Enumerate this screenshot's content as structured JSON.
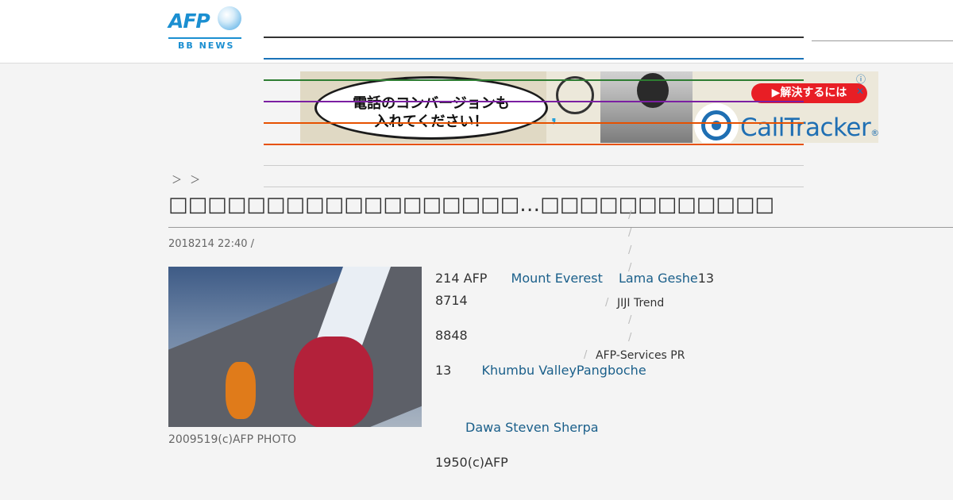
{
  "brand": {
    "logo": "AFP",
    "logo_sub": "BB NEWS"
  },
  "ad": {
    "bubble_line1": "電話のコンバージョンも",
    "bubble_line2": "入れてください！",
    "cta": "▶解決するには",
    "brand": "CallTracker",
    "brand_mark": "®",
    "info_icon": "ⓘ",
    "close_icon": "✕"
  },
  "colors": {
    "nav_lines": [
      "#333333",
      "#1a73b8",
      "#2e7d32",
      "#7b1fa2",
      "#e65100",
      "#e65100",
      "#cccccc",
      "#cccccc"
    ]
  },
  "breadcrumb": "＞ ＞",
  "article": {
    "title": "□□□□□□□□□□□□□□□□□□…□□□□□□□□□□□□",
    "meta": "2018214 22:40  /",
    "photo_caption": "2009519(c)AFP PHOTO",
    "p1_a": "214 AFP",
    "p1_link1": "Mount Everest",
    "p1_link2": "Lama Geshe",
    "p1_b": "13",
    "p2": "8714",
    "p3": "8848",
    "p4_a": "13",
    "p4_link": "Khumbu ValleyPangboche",
    "p5_link": "Dawa Steven Sherpa",
    "p6": "1950(c)AFP"
  },
  "sidebar": {
    "item1": "JIJI Trend",
    "item2": "AFP-Services PR"
  }
}
